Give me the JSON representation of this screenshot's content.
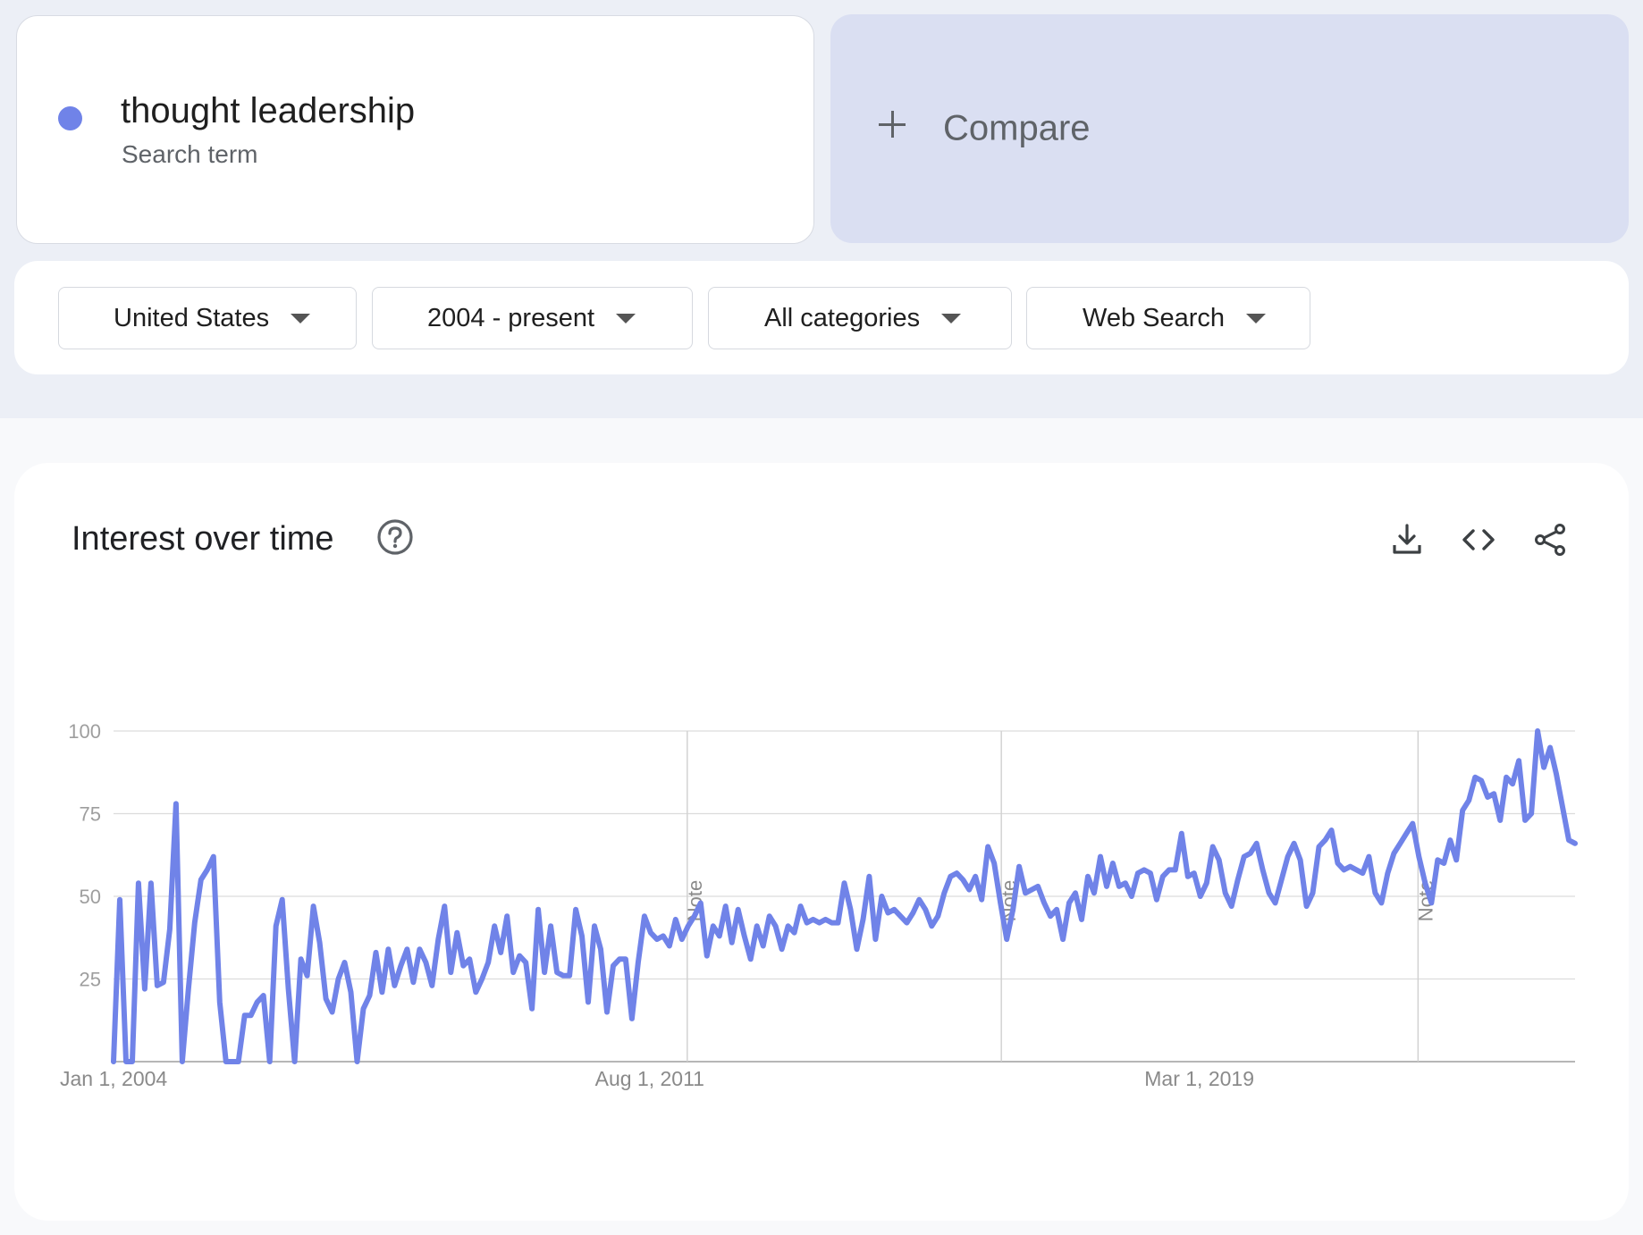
{
  "search_term": {
    "name": "thought leadership",
    "subtitle": "Search term",
    "color": "#7083e8"
  },
  "compare": {
    "label": "Compare",
    "plus_icon": "plus-icon",
    "background": "#dadff2"
  },
  "filters": [
    {
      "label": "United States",
      "icon": "caret-down-icon"
    },
    {
      "label": "2004 - present",
      "icon": "caret-down-icon"
    },
    {
      "label": "All categories",
      "icon": "caret-down-icon"
    },
    {
      "label": "Web Search",
      "icon": "caret-down-icon"
    }
  ],
  "chart_section": {
    "title": "Interest over time",
    "help_icon": "help-circle-icon",
    "actions": [
      {
        "name": "download",
        "icon": "download-icon"
      },
      {
        "name": "embed",
        "icon": "code-icon"
      },
      {
        "name": "share",
        "icon": "share-icon"
      }
    ]
  },
  "chart_data": {
    "type": "line",
    "title": "",
    "xlabel": "",
    "ylabel": "",
    "ylim": [
      0,
      100
    ],
    "yticks": [
      25,
      50,
      75,
      100
    ],
    "xticks": [
      "Jan 1, 2004",
      "Aug 1, 2011",
      "Mar 1, 2019"
    ],
    "x_range": [
      "2004-01",
      "2024-03"
    ],
    "grid": true,
    "line_color": "#7083e8",
    "notes": [
      {
        "x": "2011-12",
        "label": "Note"
      },
      {
        "x": "2016-04",
        "label": "Note"
      },
      {
        "x": "2022-01",
        "label": "Note"
      }
    ],
    "series": [
      {
        "start": "2004-01",
        "frequency": "monthly",
        "values": [
          0,
          49,
          0,
          0,
          54,
          22,
          54,
          23,
          24,
          40,
          78,
          0,
          22,
          42,
          55,
          58,
          62,
          18,
          0,
          0,
          0,
          14,
          14,
          18,
          20,
          0,
          41,
          49,
          22,
          0,
          31,
          26,
          47,
          36,
          19,
          15,
          25,
          30,
          21,
          0,
          16,
          20,
          33,
          21,
          34,
          23,
          29,
          34,
          24,
          34,
          30,
          23,
          37,
          47,
          27,
          39,
          29,
          31,
          21,
          25,
          30,
          41,
          33,
          44,
          27,
          32,
          30,
          16,
          46,
          27,
          41,
          27,
          26,
          26,
          46,
          38,
          18,
          41,
          34,
          15,
          29,
          31,
          31,
          13,
          30,
          44,
          39,
          37,
          38,
          35,
          43,
          37,
          41,
          44,
          48,
          32,
          41,
          38,
          47,
          36,
          46,
          38,
          31,
          41,
          35,
          44,
          41,
          34,
          41,
          39,
          47,
          42,
          43,
          42,
          43,
          42,
          42,
          54,
          46,
          34,
          43,
          56,
          37,
          50,
          45,
          46,
          44,
          42,
          45,
          49,
          46,
          41,
          44,
          51,
          56,
          57,
          55,
          52,
          56,
          49,
          65,
          60,
          48,
          37,
          46,
          59,
          51,
          52,
          53,
          48,
          44,
          46,
          37,
          48,
          51,
          43,
          56,
          51,
          62,
          53,
          60,
          53,
          54,
          50,
          57,
          58,
          57,
          49,
          56,
          58,
          58,
          69,
          56,
          57,
          50,
          54,
          65,
          61,
          51,
          47,
          55,
          62,
          63,
          66,
          58,
          51,
          48,
          55,
          62,
          66,
          61,
          47,
          51,
          65,
          67,
          70,
          60,
          58,
          59,
          58,
          57,
          62,
          51,
          48,
          57,
          63,
          66,
          69,
          72,
          62,
          54,
          48,
          61,
          60,
          67,
          61,
          76,
          79,
          86,
          85,
          80,
          81,
          73,
          86,
          84,
          91,
          73,
          75,
          100,
          89,
          95,
          87,
          77,
          67,
          66
        ]
      }
    ]
  }
}
